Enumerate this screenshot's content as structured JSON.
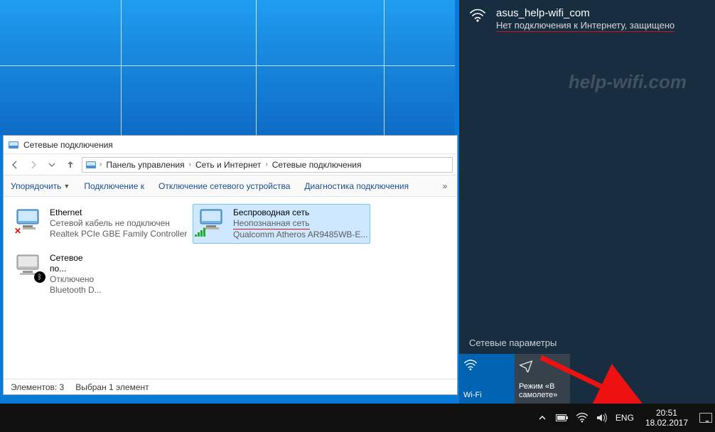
{
  "desktop": {
    "watermark": "help-wifi.com"
  },
  "explorer": {
    "title": "Сетевые подключения",
    "breadcrumbs": {
      "root_icon": "control-panel",
      "items": [
        "Панель управления",
        "Сеть и Интернет",
        "Сетевые подключения"
      ]
    },
    "commands": {
      "organize": "Упорядочить",
      "connect_to": "Подключение к",
      "disable_device": "Отключение сетевого устройства",
      "diagnose": "Диагностика подключения"
    },
    "adapters": [
      {
        "name": "Ethernet",
        "status": "Сетевой кабель не подключен",
        "device": "Realtek PCIe GBE Family Controller",
        "badge": "x",
        "selected": false
      },
      {
        "name": "Беспроводная сеть",
        "status": "Неопознанная сеть",
        "device": "Qualcomm Atheros AR9485WB-E...",
        "badge": "bars",
        "selected": true,
        "status_underlined": true
      },
      {
        "name": "Сетевое по...",
        "status": "Отключено",
        "device": "Bluetooth D...",
        "badge": "bt",
        "selected": false
      }
    ],
    "statusbar": {
      "count_label": "Элементов: 3",
      "selection_label": "Выбран 1 элемент"
    }
  },
  "flyout": {
    "ssid": "asus_help-wifi_com",
    "status": "Нет подключения к Интернету, защищено",
    "settings_label": "Сетевые параметры",
    "tiles": {
      "wifi": "Wi-Fi",
      "airplane": "Режим «В самолете»"
    }
  },
  "taskbar": {
    "lang": "ENG",
    "time": "20:51",
    "date": "18.02.2017"
  }
}
